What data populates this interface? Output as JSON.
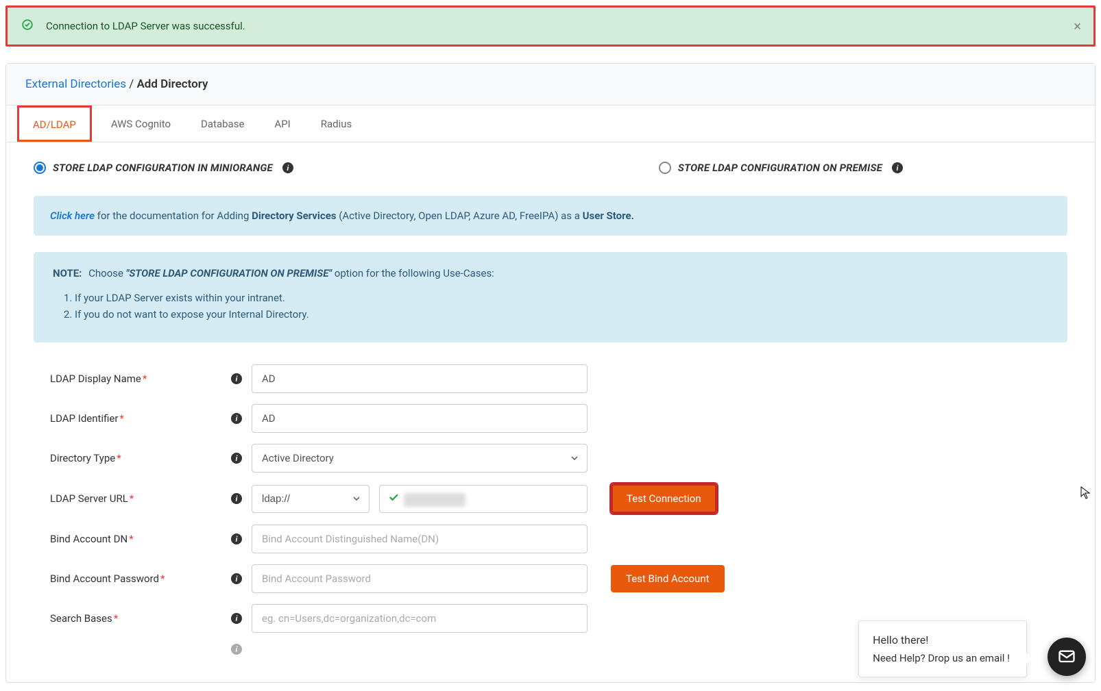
{
  "alert": {
    "text": "Connection to LDAP Server was successful."
  },
  "breadcrumb": {
    "link": "External Directories",
    "sep": " / ",
    "active": "Add Directory"
  },
  "tabs": [
    "AD/LDAP",
    "AWS Cognito",
    "Database",
    "API",
    "Radius"
  ],
  "radios": {
    "miniorange": "STORE LDAP CONFIGURATION IN MINIORANGE",
    "onpremise": "STORE LDAP CONFIGURATION ON PREMISE"
  },
  "doc": {
    "click": "Click here",
    "t1": " for the documentation for Adding ",
    "bold1": "Directory Services",
    "t2": " (Active Directory, Open LDAP, Azure AD, FreeIPA) as a ",
    "bold2": "User Store."
  },
  "note": {
    "label": "NOTE:",
    "choose": "Choose ",
    "quote": "\"STORE LDAP CONFIGURATION ON PREMISE\"",
    "tail": " option for the following Use-Cases:",
    "items": [
      "If your LDAP Server exists within your intranet.",
      "If you do not want to expose your Internal Directory."
    ]
  },
  "form": {
    "displayName": {
      "label": "LDAP Display Name",
      "value": "AD"
    },
    "identifier": {
      "label": "LDAP Identifier",
      "value": "AD"
    },
    "dirType": {
      "label": "Directory Type",
      "value": "Active Directory"
    },
    "serverUrl": {
      "label": "LDAP Server URL",
      "proto": "ldap://",
      "value": ""
    },
    "bindDn": {
      "label": "Bind Account DN",
      "placeholder": "Bind Account Distinguished Name(DN)"
    },
    "bindPw": {
      "label": "Bind Account Password",
      "placeholder": "Bind Account Password"
    },
    "searchBases": {
      "label": "Search Bases",
      "placeholder": "eg. cn=Users,dc=organization,dc=com"
    }
  },
  "buttons": {
    "testConn": "Test Connection",
    "testBind": "Test Bind Account"
  },
  "chat": {
    "line1": "Hello there!",
    "line2": "Need Help? Drop us an email !"
  }
}
